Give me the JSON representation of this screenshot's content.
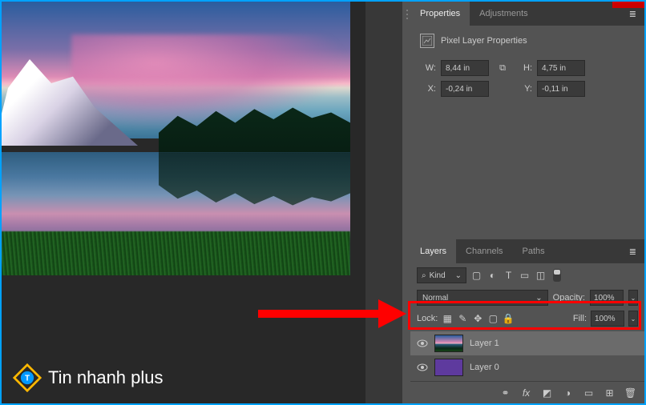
{
  "logo": {
    "text": "Tin nhanh plus"
  },
  "properties": {
    "tab_properties": "Properties",
    "tab_adjustments": "Adjustments",
    "title": "Pixel Layer Properties",
    "w_label": "W:",
    "w_value": "8,44 in",
    "h_label": "H:",
    "h_value": "4,75 in",
    "x_label": "X:",
    "x_value": "-0,24 in",
    "y_label": "Y:",
    "y_value": "-0,11 in"
  },
  "layers": {
    "tab_layers": "Layers",
    "tab_channels": "Channels",
    "tab_paths": "Paths",
    "kind_label": "Kind",
    "blend_mode": "Normal",
    "opacity_label": "Opacity:",
    "opacity_value": "100%",
    "lock_label": "Lock:",
    "fill_label": "Fill:",
    "fill_value": "100%",
    "items": [
      {
        "name": "Layer 1"
      },
      {
        "name": "Layer 0"
      }
    ]
  },
  "icons": {
    "search": "⌕",
    "chevron": "⌄",
    "image": "▢",
    "adjust": "◐",
    "type": "T",
    "shape": "▭",
    "smart": "◫",
    "link": "⚭",
    "fx": "fx",
    "mask": "◩",
    "fill": "◑",
    "group": "▭",
    "new": "⊞",
    "trash": "🗑",
    "eye": "👁",
    "menu": "≣",
    "pixels": "▦",
    "brush": "✎",
    "move": "✥",
    "square": "▢",
    "lock": "🔒"
  }
}
